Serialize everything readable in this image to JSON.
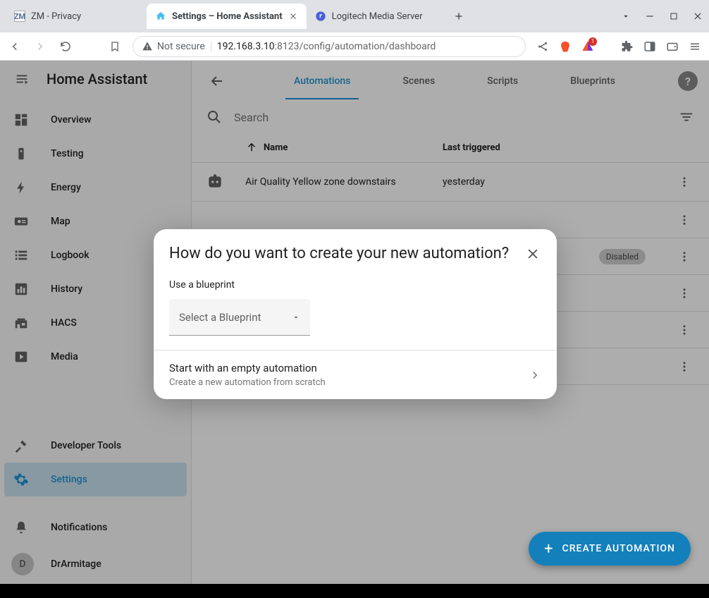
{
  "browser": {
    "tabs": [
      {
        "title": "ZM - Privacy",
        "favicon": "ZM"
      },
      {
        "title": "Settings – Home Assistant",
        "favicon": "HA"
      },
      {
        "title": "Logitech Media Server",
        "favicon": "LMS"
      }
    ],
    "url_scheme": "Not secure",
    "url_host": "192.168.3.10",
    "url_path": ":8123/config/automation/dashboard"
  },
  "app": {
    "title": "Home Assistant",
    "nav": [
      "Overview",
      "Testing",
      "Energy",
      "Map",
      "Logbook",
      "History",
      "HACS",
      "Media"
    ],
    "nav_bottom": [
      "Developer Tools",
      "Settings"
    ],
    "notifications": "Notifications",
    "user": {
      "initial": "D",
      "name": "DrArmitage"
    }
  },
  "main": {
    "tabs": [
      "Automations",
      "Scenes",
      "Scripts",
      "Blueprints"
    ],
    "search_placeholder": "Search",
    "columns": {
      "name": "Name",
      "last": "Last triggered"
    },
    "rows": [
      {
        "name": "Air Quality Yellow zone downstairs",
        "last": "yesterday"
      }
    ],
    "disabled_chip": "Disabled",
    "fab": "CREATE AUTOMATION"
  },
  "dialog": {
    "title": "How do you want to create your new automation?",
    "blueprint_label": "Use a blueprint",
    "blueprint_placeholder": "Select a Blueprint",
    "empty_title": "Start with an empty automation",
    "empty_subtitle": "Create a new automation from scratch"
  }
}
